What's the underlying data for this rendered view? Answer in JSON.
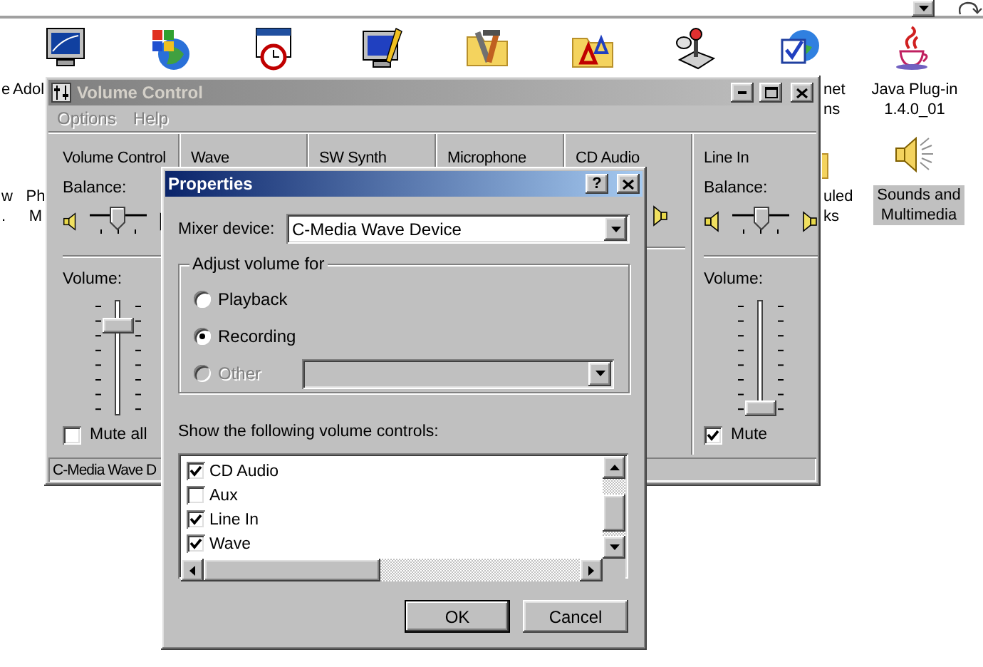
{
  "desktop": {
    "icons": [
      {
        "kind": "monitor"
      },
      {
        "kind": "windows-globe"
      },
      {
        "kind": "calendar-clock"
      },
      {
        "kind": "monitor-pencil"
      },
      {
        "kind": "folder-tools"
      },
      {
        "kind": "font-folder"
      },
      {
        "kind": "joystick"
      },
      {
        "kind": "globe-check"
      },
      {
        "kind": "java-cup"
      },
      {
        "kind": "folder"
      },
      {
        "kind": "speaker"
      }
    ],
    "labels": [
      {
        "lines": [
          "e"
        ],
        "selected": false
      },
      {
        "lines": [
          "Adol"
        ],
        "selected": false
      },
      {
        "lines": [
          "net",
          "ns"
        ],
        "selected": false
      },
      {
        "lines": [
          "Java Plug-in",
          "1.4.0_01"
        ],
        "selected": false
      },
      {
        "lines": [
          "w",
          "."
        ],
        "selected": false
      },
      {
        "lines": [
          "Ph",
          "M"
        ],
        "selected": false
      },
      {
        "lines": [
          "uled",
          "ks"
        ],
        "selected": false
      },
      {
        "lines": [
          "Sounds and",
          "Multimedia"
        ],
        "selected": true
      }
    ]
  },
  "volume_window": {
    "title": "Volume Control",
    "active": false,
    "menu": [
      {
        "label": "Options",
        "disabled": true
      },
      {
        "label": "Help",
        "disabled": true
      }
    ],
    "columns": [
      {
        "kind": "full",
        "name": "Volume Control",
        "balance_label": "Balance:",
        "balance": {
          "level": 0.5
        },
        "volume_label": "Volume:",
        "volume": {
          "level": 0.8
        },
        "mute": {
          "label": "Mute all",
          "checked": false
        }
      },
      {
        "kind": "header",
        "name": "Wave"
      },
      {
        "kind": "header",
        "name": "SW Synth"
      },
      {
        "kind": "header",
        "name": "Microphone"
      },
      {
        "kind": "partial",
        "name": "CD Audio"
      },
      {
        "kind": "full",
        "name": "Line In",
        "balance_label": "Balance:",
        "balance": {
          "level": 0.5
        },
        "volume_label": "Volume:",
        "volume": {
          "level": 0
        },
        "mute": {
          "label": "Mute",
          "checked": true
        }
      }
    ],
    "status": "C-Media Wave D"
  },
  "dialog": {
    "title": "Properties",
    "active": true,
    "help_button": "?",
    "mixer_label": "Mixer device:",
    "mixer_value": "C-Media Wave Device",
    "group_title": "Adjust volume for",
    "options": [
      {
        "label": "Playback",
        "selected": false,
        "disabled": false
      },
      {
        "label": "Recording",
        "selected": true,
        "disabled": false
      },
      {
        "label": "Other",
        "selected": false,
        "disabled": true
      }
    ],
    "list_label": "Show the following volume controls:",
    "list_items": [
      {
        "label": "CD Audio",
        "checked": true
      },
      {
        "label": "Aux",
        "checked": false
      },
      {
        "label": "Line In",
        "checked": true
      },
      {
        "label": "Wave",
        "checked": true
      }
    ],
    "buttons": [
      {
        "label": "OK",
        "default": true
      },
      {
        "label": "Cancel",
        "default": false
      }
    ]
  }
}
